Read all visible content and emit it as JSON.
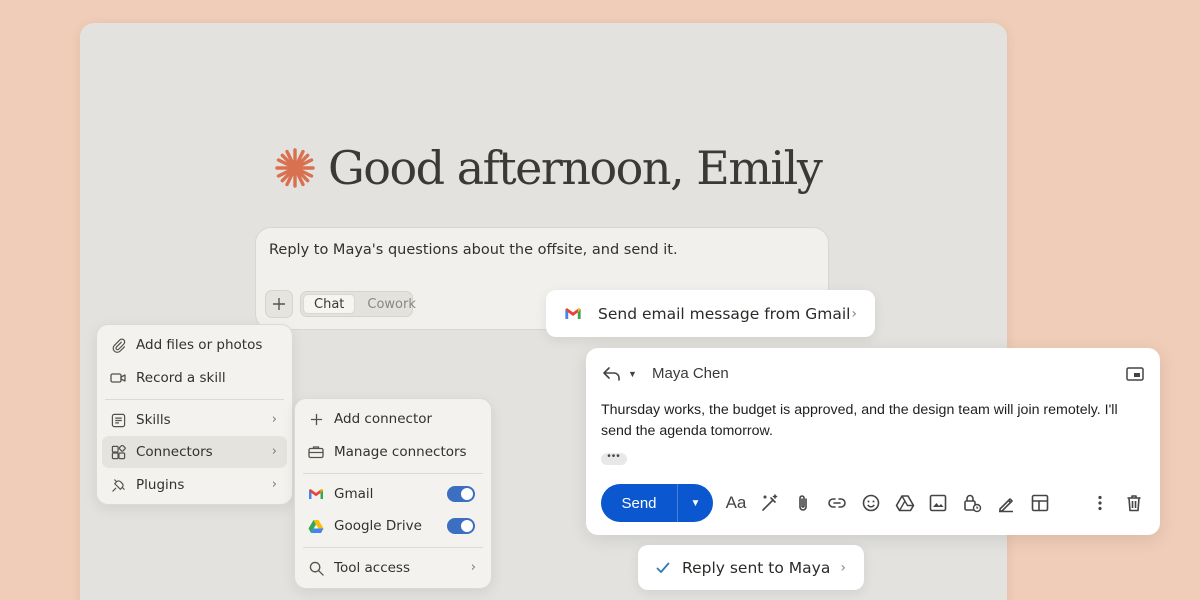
{
  "greeting": "Good afternoon, Emily",
  "prompt": {
    "text": "Reply to Maya's questions about the offsite, and send it.",
    "modes": [
      "Chat",
      "Cowork"
    ],
    "active_mode": "Chat"
  },
  "attach_menu": {
    "items": [
      {
        "label": "Add files or photos",
        "icon": "paperclip-icon"
      },
      {
        "label": "Record a skill",
        "icon": "video-camera-icon"
      },
      {
        "label": "Skills",
        "icon": "skills-icon"
      },
      {
        "label": "Connectors",
        "icon": "connectors-icon"
      },
      {
        "label": "Plugins",
        "icon": "plug-icon"
      }
    ]
  },
  "connectors_menu": {
    "items": [
      {
        "label": "Add connector",
        "icon": "plus-icon"
      },
      {
        "label": "Manage connectors",
        "icon": "briefcase-icon"
      },
      {
        "label": "Gmail",
        "icon": "gmail-icon",
        "enabled": true
      },
      {
        "label": "Google Drive",
        "icon": "google-drive-icon",
        "enabled": true
      },
      {
        "label": "Tool access",
        "icon": "search-icon"
      }
    ]
  },
  "tool_pill": {
    "label": "Send email message from Gmail",
    "icon": "gmail-icon"
  },
  "email": {
    "recipient": "Maya Chen",
    "body": "Thursday works, the budget is approved, and the design team will join remotely. I'll send the agenda tomorrow.",
    "send_label": "Send",
    "format_label": "Aa"
  },
  "status_pill": {
    "label": "Reply sent to Maya",
    "icon": "check-icon"
  },
  "colors": {
    "background": "#f0cdb8",
    "accent": "#d9704f",
    "send_button": "#0b57d0",
    "toggle_on": "#3c6fc2"
  }
}
